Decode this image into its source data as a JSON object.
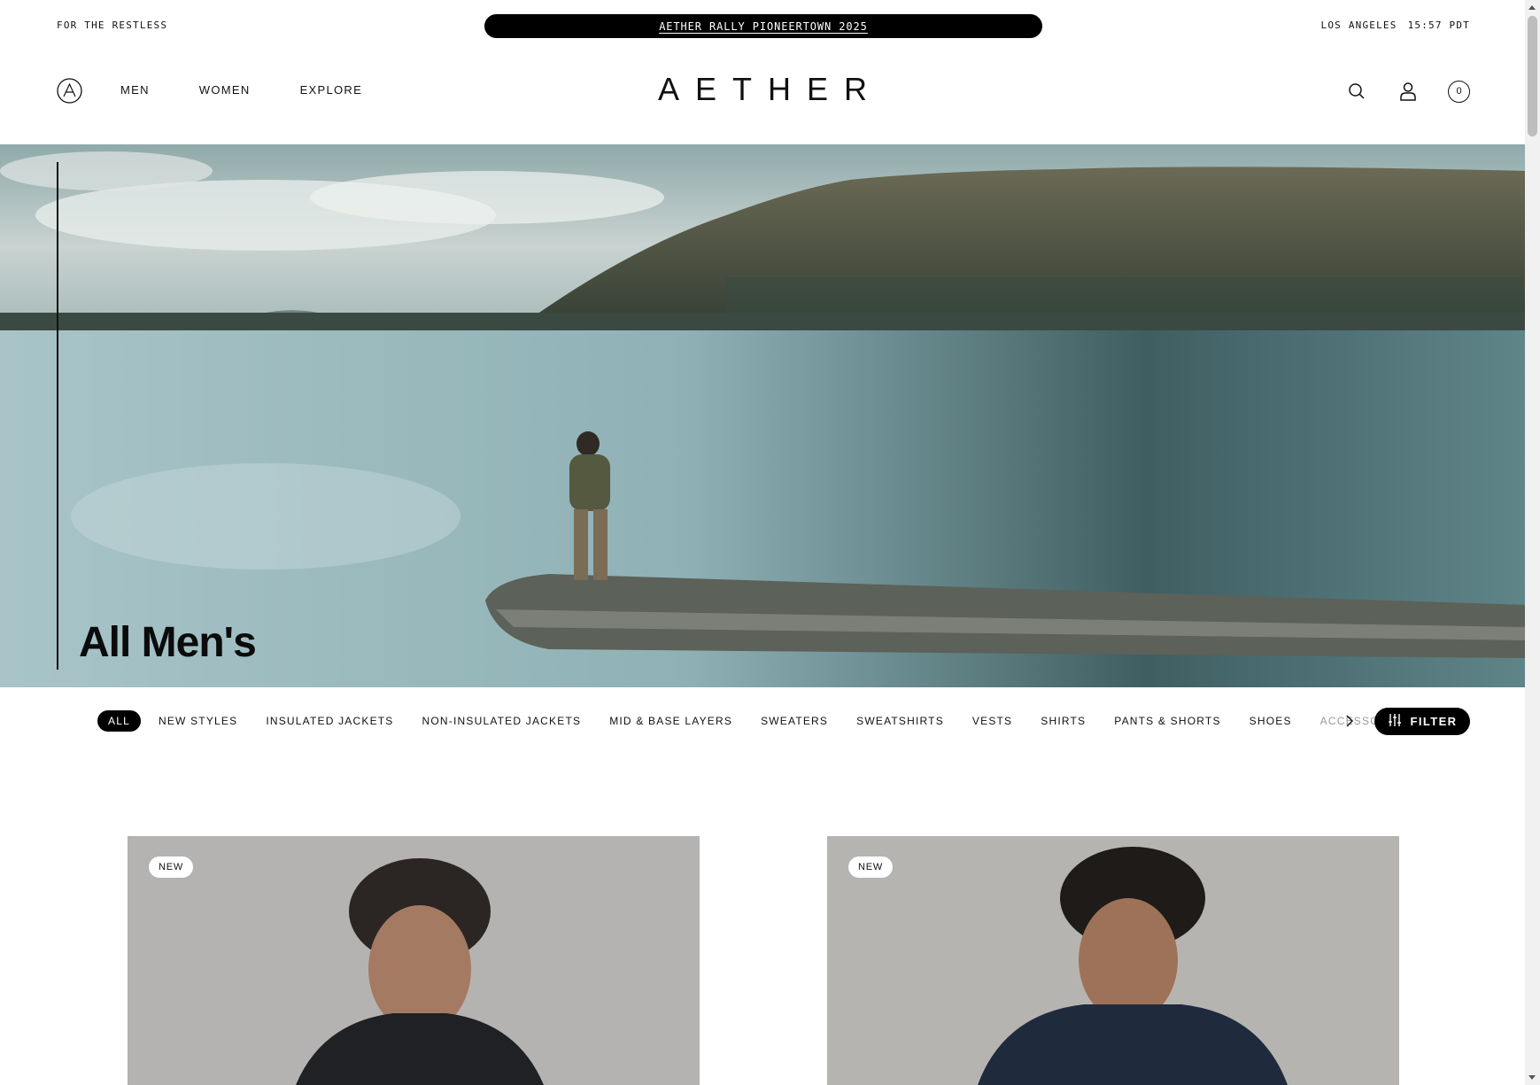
{
  "utility": {
    "tagline": "FOR THE RESTLESS",
    "promo": "AETHER RALLY PIONEERTOWN 2025",
    "city": "LOS ANGELES",
    "time": "15:57 PDT"
  },
  "nav": {
    "links": [
      "MEN",
      "WOMEN",
      "EXPLORE"
    ],
    "brand": "AETHER",
    "icons": [
      "search-icon",
      "account-icon",
      "cart-icon"
    ],
    "cart_count": "0"
  },
  "hero": {
    "title": "All Men's"
  },
  "categories": {
    "items": [
      "ALL",
      "NEW STYLES",
      "INSULATED JACKETS",
      "NON-INSULATED JACKETS",
      "MID & BASE LAYERS",
      "SWEATERS",
      "SWEATSHIRTS",
      "VESTS",
      "SHIRTS",
      "PANTS & SHORTS",
      "SHOES",
      "ACCESSORIES"
    ],
    "active": "ALL",
    "filter_label": "FILTER"
  },
  "products": [
    {
      "badge": "NEW"
    },
    {
      "badge": "NEW"
    }
  ],
  "colors": {
    "accent": "#000000",
    "background": "#ffffff",
    "card_bg": "#b3b3b1"
  }
}
